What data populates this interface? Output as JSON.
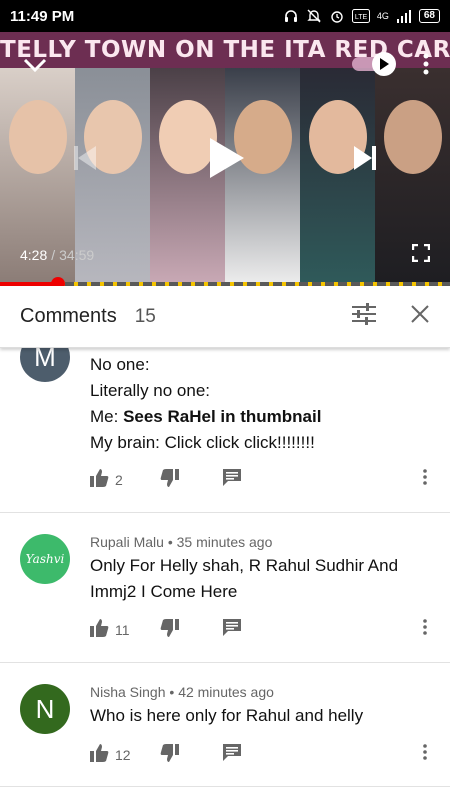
{
  "status": {
    "time": "11:49 PM",
    "battery": "68",
    "network": "4G"
  },
  "player": {
    "thumbnail_title": "TELLY TOWN ON THE ITA RED CARPET",
    "time_current": "4:28",
    "time_separator": "/",
    "time_total": "34:59",
    "progress": 0.128
  },
  "comments_header": {
    "title": "Comments",
    "count": "15"
  },
  "comments": [
    {
      "avatar_letter": "M",
      "avatar_color": "#4d5d6c",
      "lines": [
        "No one:",
        "Literally no one:"
      ],
      "bold_prefix": "Me: ",
      "bold_text": "Sees RaHel in thumbnail",
      "last_line": "My brain: Click click click!!!!!!!!",
      "likes": "2"
    },
    {
      "avatar_text": "Yashvi",
      "avatar_color": "#3dba6b",
      "author": "Rupali Malu",
      "time": "35 minutes ago",
      "text_line1": "Only For Helly shah, R Rahul Sudhir And",
      "text_line2": "Immj2 I Come Here",
      "likes": "11"
    },
    {
      "avatar_letter": "N",
      "avatar_color": "#33691e",
      "author": "Nisha Singh",
      "time": "42 minutes ago",
      "text_line1": "Who is here only for Rahul and helly",
      "likes": "12"
    }
  ],
  "meta_separator": "•"
}
